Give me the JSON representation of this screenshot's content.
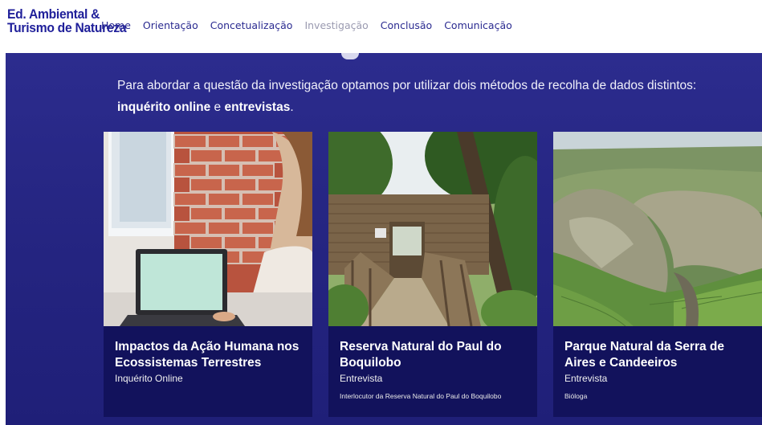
{
  "logo": {
    "line1": "Ed. Ambiental &",
    "line2": "Turismo de Natureza"
  },
  "nav": [
    {
      "label": "Home"
    },
    {
      "label": "Orientação"
    },
    {
      "label": "Concetualização"
    },
    {
      "label": "Investigação",
      "active": true
    },
    {
      "label": "Conclusão"
    },
    {
      "label": "Comunicação"
    }
  ],
  "intro": {
    "text_before": "Para abordar a questão da investigação optamos por utilizar dois métodos de recolha de dados distintos: ",
    "method1": "inquérito online",
    "conjunction": " e ",
    "method2": "entrevistas",
    "end": "."
  },
  "cards": [
    {
      "title": "Impactos da Ação Humana nos Ecossistemas Terrestres",
      "subtitle": "Inquérito Online",
      "detail": ""
    },
    {
      "title": "Reserva Natural do Paul do Boquilobo",
      "subtitle": "Entrevista",
      "detail": "Interlocutor da Reserva Natural do Paul do Boquilobo"
    },
    {
      "title": "Parque Natural da Serra de Aires e Candeeiros",
      "subtitle": "Entrevista",
      "detail": "Bióloga"
    }
  ],
  "colors": {
    "brand": "#20209a",
    "band": "#262683",
    "card": "#12125c",
    "nav_active": "#9a9ab0"
  }
}
